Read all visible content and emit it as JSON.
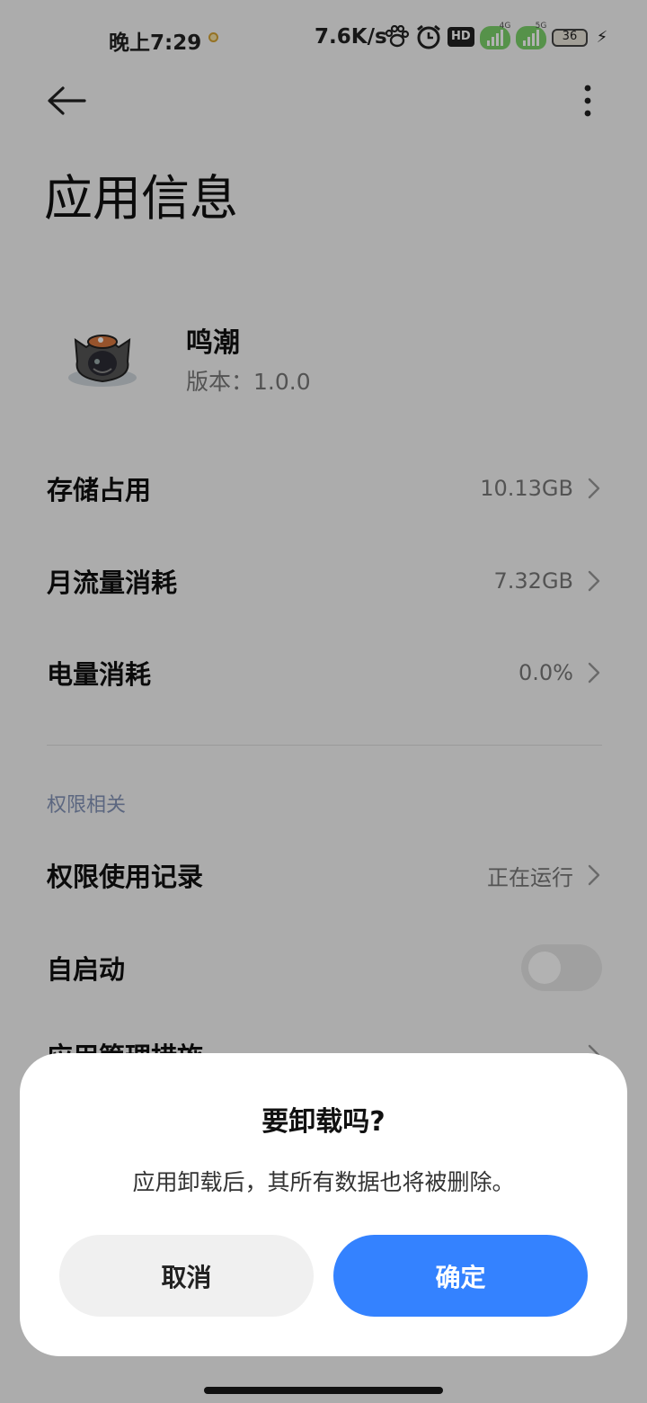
{
  "status_bar": {
    "time": "晚上7:29",
    "net_speed": "7.6K/s",
    "hd_label": "HD",
    "sig1_tag": "4G",
    "sig2_tag": "5G",
    "battery": "36",
    "icons": [
      "notification-dot-icon",
      "paw-icon",
      "alarm-clock-icon",
      "hd-icon",
      "signal-4g-icon",
      "signal-5g-icon",
      "battery-icon",
      "charging-icon"
    ]
  },
  "header": {
    "title": "应用信息"
  },
  "app": {
    "name": "鸣潮",
    "version": "版本：1.0.0"
  },
  "rows": {
    "storage": {
      "label": "存储占用",
      "value": "10.13GB"
    },
    "data_usage": {
      "label": "月流量消耗",
      "value": "7.32GB"
    },
    "battery": {
      "label": "电量消耗",
      "value": "0.0%"
    }
  },
  "permissions": {
    "section_label": "权限相关",
    "record": {
      "label": "权限使用记录",
      "value": "正在运行"
    },
    "autostart": {
      "label": "自启动",
      "enabled": false
    },
    "partial_label": "应用管理措施"
  },
  "dialog": {
    "title": "要卸载吗?",
    "message": "应用卸载后，其所有数据也将被删除。",
    "cancel": "取消",
    "confirm": "确定"
  },
  "colors": {
    "accent": "#3482ff",
    "section_label": "#8494b8",
    "secondary_text": "#777777"
  }
}
